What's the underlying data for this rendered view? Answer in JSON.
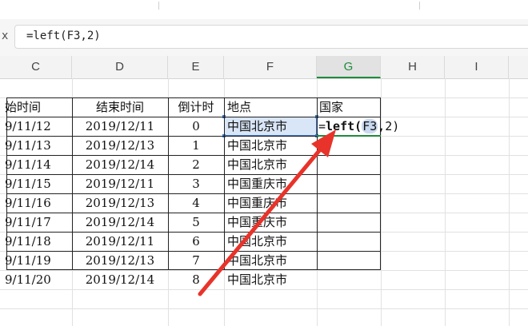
{
  "formula_bar": {
    "label": "x",
    "value": "=left(F3,2)"
  },
  "columns": [
    "C",
    "D",
    "E",
    "F",
    "G",
    "H",
    "I"
  ],
  "active_column": "G",
  "table": {
    "headers": {
      "start": "始时间",
      "end": "结束时间",
      "countdown": "倒计时",
      "place": "地点",
      "country": "国家"
    },
    "rows": [
      {
        "start": "9/11/12",
        "end": "2019/12/11",
        "countdown": "0",
        "place": "中国北京市"
      },
      {
        "start": "9/11/13",
        "end": "2019/12/13",
        "countdown": "1",
        "place": "中国北京市"
      },
      {
        "start": "9/11/14",
        "end": "2019/12/14",
        "countdown": "2",
        "place": "中国北京市"
      },
      {
        "start": "9/11/15",
        "end": "2019/12/11",
        "countdown": "3",
        "place": "中国重庆市"
      },
      {
        "start": "9/11/16",
        "end": "2019/12/13",
        "countdown": "4",
        "place": "中国重庆市"
      },
      {
        "start": "9/11/17",
        "end": "2019/12/14",
        "countdown": "5",
        "place": "中国重庆市"
      },
      {
        "start": "9/11/18",
        "end": "2019/12/11",
        "countdown": "6",
        "place": "中国北京市"
      },
      {
        "start": "9/11/19",
        "end": "2019/12/13",
        "countdown": "7",
        "place": "中国北京市"
      },
      {
        "start": "9/11/20",
        "end": "2019/12/14",
        "countdown": "8",
        "place": "中国北京市"
      }
    ]
  },
  "editing_cell": {
    "prefix": "=",
    "function": "left",
    "open": "(",
    "reference": "F3",
    "rest": ",2)"
  },
  "colors": {
    "active_green": "#1e8b3a",
    "reference_blue": "#3d74c4",
    "arrow_red": "#e8332a"
  },
  "annotation": {
    "icon": "red-arrow-icon"
  }
}
